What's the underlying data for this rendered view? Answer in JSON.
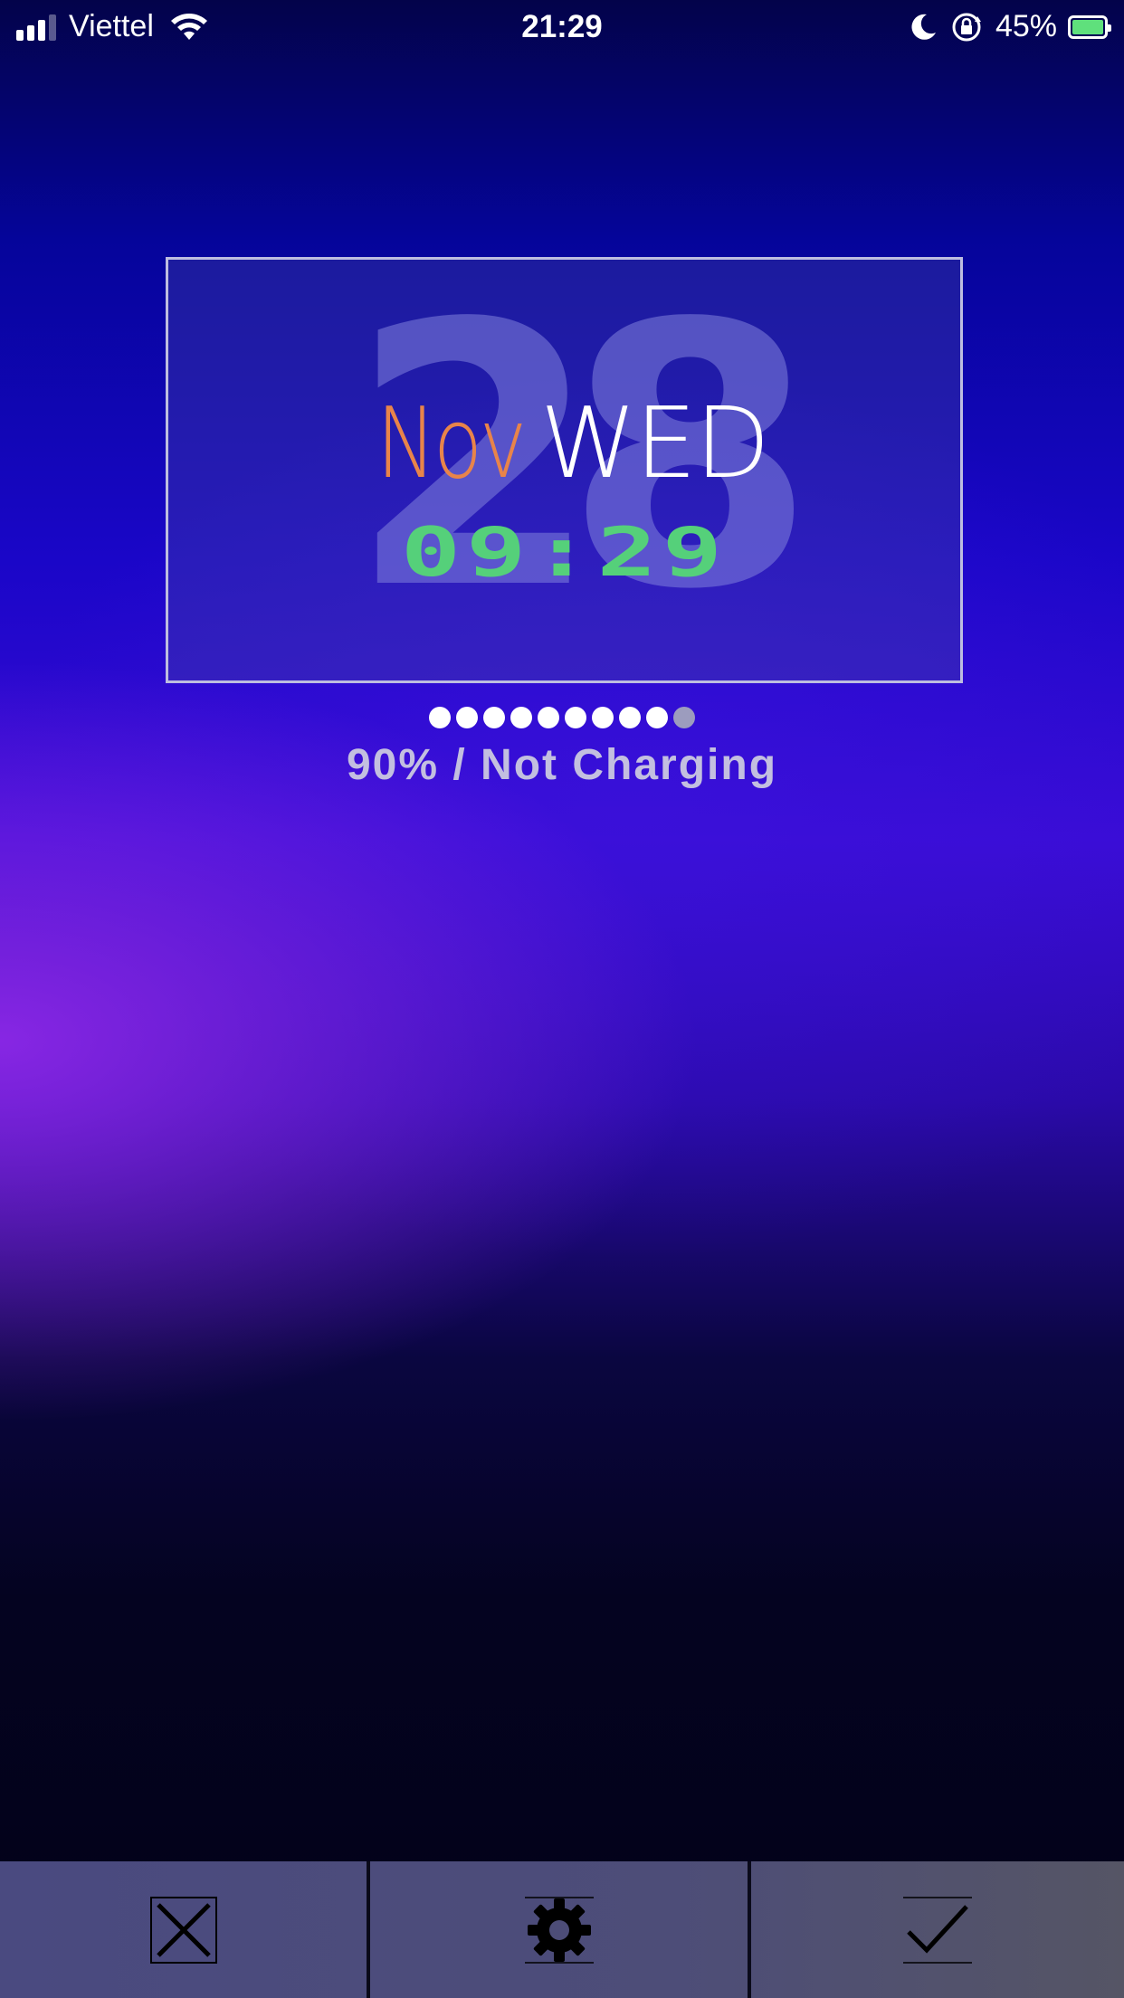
{
  "status_bar": {
    "carrier": "Viettel",
    "time": "21:29",
    "battery_percent": "45%",
    "battery_level": 0.45,
    "icons": [
      "signal-icon",
      "wifi-icon",
      "moon-icon",
      "rotation-lock-icon",
      "battery-icon"
    ]
  },
  "widget": {
    "day": "28",
    "month": "Nov",
    "weekday": "WED",
    "time": "09:29",
    "colors": {
      "month": "#e8844a",
      "weekday": "#ffffff",
      "time": "#55d07a",
      "day": "#8282dc"
    }
  },
  "battery": {
    "dots_total": 10,
    "dots_filled": 9,
    "status_text": "90% / Not Charging"
  },
  "toolbar": {
    "buttons": [
      {
        "icon": "close-icon"
      },
      {
        "icon": "gear-icon"
      },
      {
        "icon": "checkmark-icon"
      }
    ]
  }
}
